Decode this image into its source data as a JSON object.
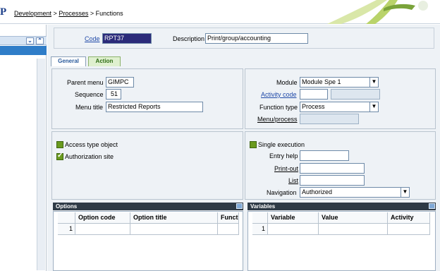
{
  "breadcrumb": {
    "items": [
      "Development",
      "Processes",
      "Functions"
    ],
    "separator": ">"
  },
  "header_bar": {
    "code_label": "Code",
    "code_value": "RPT37",
    "description_label": "Description",
    "description_value": "Print/group/accounting"
  },
  "tabs": [
    {
      "label": "General",
      "active": true
    },
    {
      "label": "Action",
      "active": false
    }
  ],
  "general_left": {
    "parent_menu_label": "Parent menu",
    "parent_menu_value": "GIMPC",
    "sequence_label": "Sequence",
    "sequence_value": "51",
    "menu_title_label": "Menu title",
    "menu_title_value": "Restricted Reports"
  },
  "general_right": {
    "module_label": "Module",
    "module_value": "Module Spe 1",
    "activity_code_label": "Activity code",
    "activity_code_value": "",
    "activity_code_desc": "",
    "function_type_label": "Function type",
    "function_type_value": "Process",
    "menu_process_label": "Menu/process",
    "menu_process_value": ""
  },
  "checks_left": {
    "access_type_label": "Access type object",
    "access_type_checked": false,
    "authorization_site_label": "Authorization site",
    "authorization_site_checked": true
  },
  "checks_right": {
    "single_execution_label": "Single execution",
    "single_execution_checked": false,
    "entry_help_label": "Entry help",
    "entry_help_value": "",
    "print_out_label": "Print-out",
    "print_out_value": "",
    "list_label": "List",
    "list_value": "",
    "navigation_label": "Navigation",
    "navigation_value": "Authorized"
  },
  "options_grid": {
    "title": "Options",
    "columns": [
      "Option code",
      "Option title",
      "Funct"
    ],
    "rows": [
      {
        "num": "1",
        "cells": [
          "",
          "",
          ""
        ]
      }
    ]
  },
  "variables_grid": {
    "title": "Variables",
    "columns": [
      "Variable",
      "Value",
      "Activity"
    ],
    "rows": [
      {
        "num": "1",
        "cells": [
          "",
          "",
          ""
        ]
      }
    ]
  },
  "colors": {
    "accent_blue": "#2f7dc8",
    "link_blue": "#1f49a8",
    "tab_green": "#8cb26b",
    "grid_header": "#2e3a46",
    "check_green": "#6a9a1e"
  }
}
